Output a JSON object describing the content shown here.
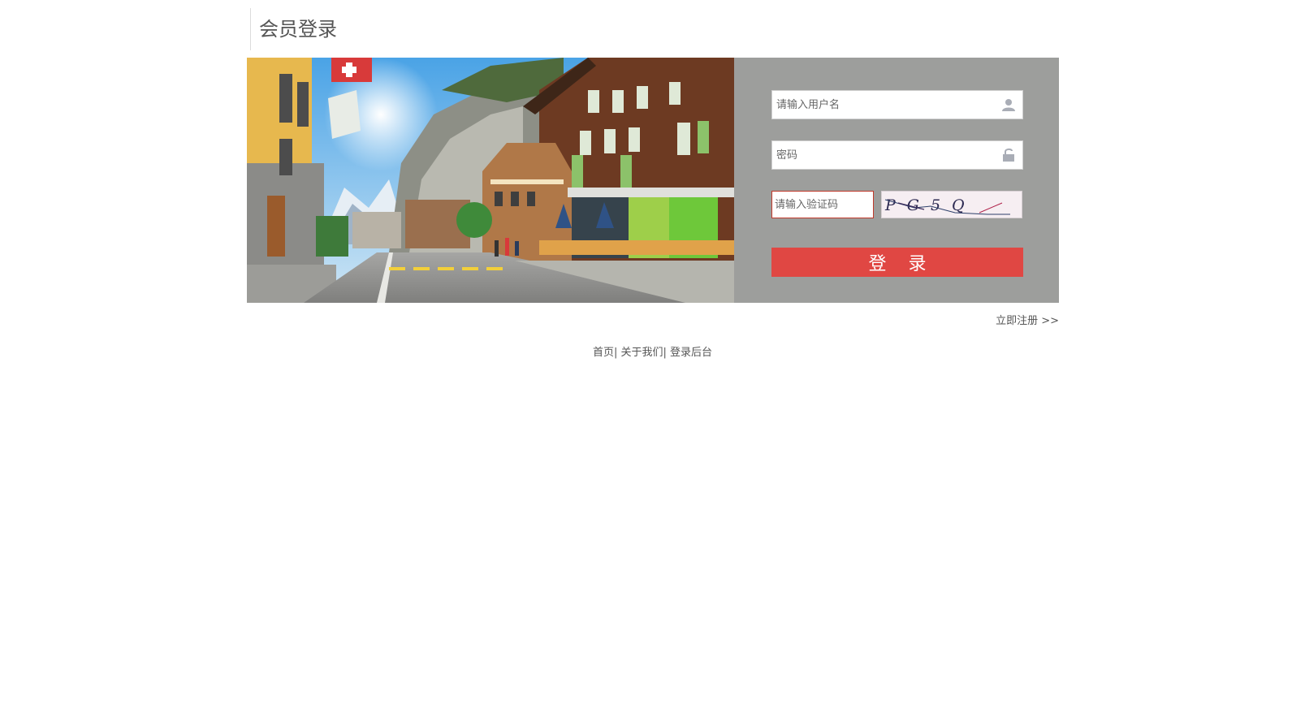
{
  "header": {
    "title": "会员登录"
  },
  "form": {
    "username_placeholder": "请输入用户名",
    "password_placeholder": "密码",
    "captcha_placeholder": "请输入验证码",
    "captcha_text": "PG5Q",
    "login_label": "登 录"
  },
  "register": {
    "label": "立即注册 >>"
  },
  "footer": {
    "links": [
      "首页",
      "关于我们",
      "登录后台"
    ],
    "separator": "|"
  },
  "icons": {
    "username": "user-icon",
    "password": "lock-icon"
  },
  "colors": {
    "panel_bg": "#9d9e9c",
    "button_bg": "#e04743",
    "captcha_border": "#c0392b"
  }
}
